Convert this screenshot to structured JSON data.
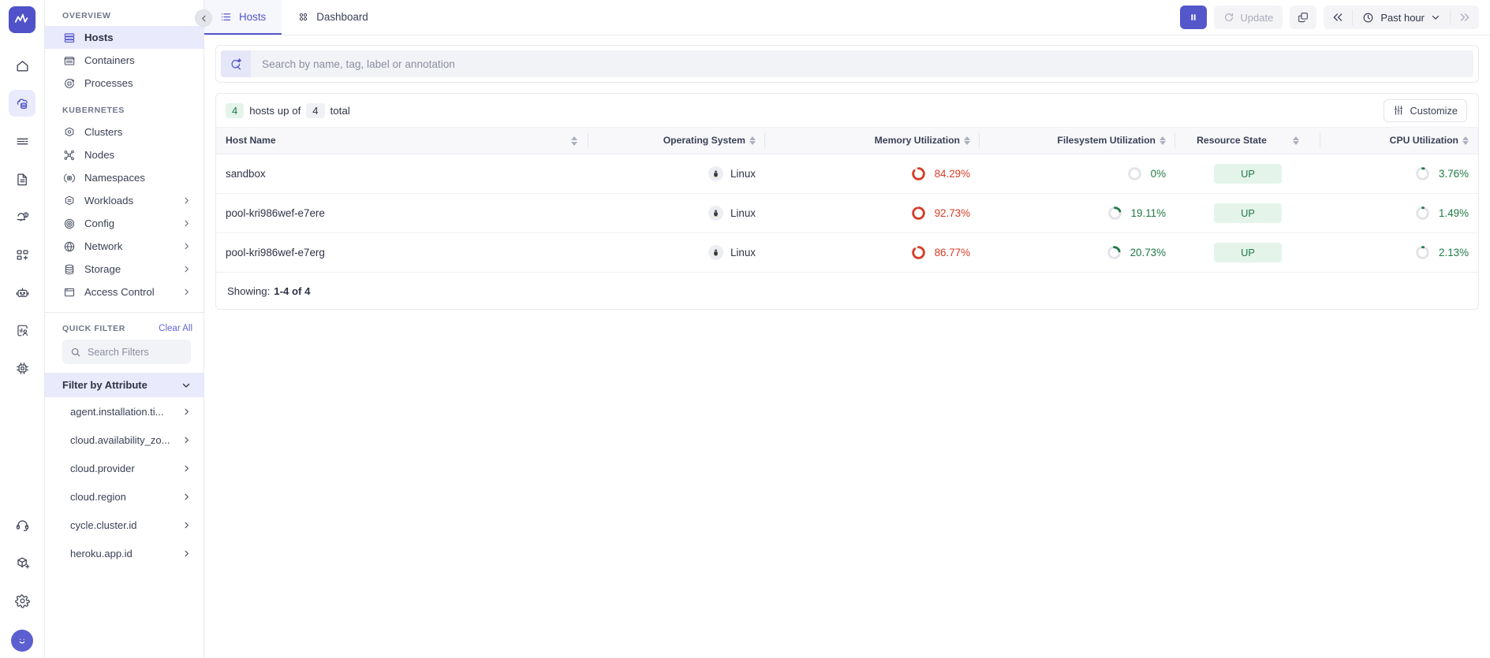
{
  "brand": {
    "logo_icon": "monitoring-wave-logo"
  },
  "rail": {
    "items": [
      {
        "name": "home",
        "icon": "home-icon",
        "active": false
      },
      {
        "name": "infrastructure",
        "icon": "cloud-stack-icon",
        "active": true
      },
      {
        "name": "logs",
        "icon": "logs-lines-icon",
        "active": false
      },
      {
        "name": "traces",
        "icon": "document-traces-icon",
        "active": false
      },
      {
        "name": "alerts",
        "icon": "alert-bell-icon",
        "active": false
      },
      {
        "name": "integrations",
        "icon": "add-node-icon",
        "active": false
      },
      {
        "name": "ai-assistant",
        "icon": "robot-icon",
        "active": false
      },
      {
        "name": "rum",
        "icon": "user-insights-icon",
        "active": false
      },
      {
        "name": "settings-chip",
        "icon": "cpu-chip-icon",
        "active": false
      }
    ],
    "bottom_items": [
      {
        "name": "support",
        "icon": "headset-icon"
      },
      {
        "name": "new-resource",
        "icon": "cube-plus-icon"
      },
      {
        "name": "settings",
        "icon": "gear-icon"
      }
    ],
    "avatar": "smiley-avatar"
  },
  "sidebar": {
    "collapse_icon": "chevron-left-icon",
    "sections": [
      {
        "label": "OVERVIEW",
        "items": [
          {
            "label": "Hosts",
            "icon": "hosts-stack-icon",
            "selected": true,
            "expandable": false
          },
          {
            "label": "Containers",
            "icon": "container-icon",
            "selected": false,
            "expandable": false
          },
          {
            "label": "Processes",
            "icon": "processes-icon",
            "selected": false,
            "expandable": false
          }
        ]
      },
      {
        "label": "KUBERNETES",
        "items": [
          {
            "label": "Clusters",
            "icon": "cluster-hex-icon",
            "selected": false,
            "expandable": false
          },
          {
            "label": "Nodes",
            "icon": "nodes-graph-icon",
            "selected": false,
            "expandable": false
          },
          {
            "label": "Namespaces",
            "icon": "namespace-icon",
            "selected": false,
            "expandable": false
          },
          {
            "label": "Workloads",
            "icon": "workloads-hex-icon",
            "selected": false,
            "expandable": true
          },
          {
            "label": "Config",
            "icon": "config-target-icon",
            "selected": false,
            "expandable": true
          },
          {
            "label": "Network",
            "icon": "globe-icon",
            "selected": false,
            "expandable": true
          },
          {
            "label": "Storage",
            "icon": "storage-db-icon",
            "selected": false,
            "expandable": true
          },
          {
            "label": "Access Control",
            "icon": "access-card-icon",
            "selected": false,
            "expandable": true
          }
        ]
      }
    ],
    "quick_filter": {
      "title": "QUICK FILTER",
      "clear_all": "Clear All",
      "search_placeholder": "Search Filters",
      "search_value": "",
      "search_icon": "search-icon",
      "attribute_header": "Filter by Attribute",
      "attribute_chevron": "chevron-down-icon",
      "attributes": [
        "agent.installation.ti...",
        "cloud.availability_zo...",
        "cloud.provider",
        "cloud.region",
        "cycle.cluster.id",
        "heroku.app.id"
      ]
    }
  },
  "topbar": {
    "tabs": [
      {
        "label": "Hosts",
        "icon": "list-icon",
        "active": true
      },
      {
        "label": "Dashboard",
        "icon": "grid-dots-icon",
        "active": false
      }
    ],
    "pause_button": {
      "name": "pause-button",
      "icon": "pause-icon"
    },
    "update_button": {
      "label": "Update",
      "icon": "refresh-icon",
      "disabled": true
    },
    "copy_button": {
      "name": "copy-button",
      "icon": "copy-icon"
    },
    "time_nav_prev": "double-chevron-left-icon",
    "time_nav_next": "double-chevron-right-icon",
    "time_range": {
      "label": "Past hour",
      "icon": "clock-icon",
      "chevron": "chevron-down-icon"
    }
  },
  "search": {
    "placeholder": "Search by name, tag, label or annotation",
    "value": "",
    "icon": "ai-search-icon"
  },
  "table": {
    "summary": {
      "up_count": "4",
      "mid_text": "hosts up of",
      "total_count": "4",
      "tail_text": "total"
    },
    "customize": {
      "label": "Customize",
      "icon": "sliders-icon"
    },
    "columns": [
      {
        "key": "host_name",
        "label": "Host Name",
        "align": "left",
        "sortable": true
      },
      {
        "key": "operating_system",
        "label": "Operating System",
        "align": "right",
        "sortable": true
      },
      {
        "key": "memory_utilization",
        "label": "Memory Utilization",
        "align": "right",
        "sortable": true
      },
      {
        "key": "filesystem_utilization",
        "label": "Filesystem Utilization",
        "align": "right",
        "sortable": true
      },
      {
        "key": "resource_state",
        "label": "Resource State",
        "align": "center",
        "sortable": true
      },
      {
        "key": "cpu_utilization",
        "label": "CPU Utilization",
        "align": "right",
        "sortable": true
      }
    ],
    "rows": [
      {
        "host_name": "sandbox",
        "operating_system": "Linux",
        "os_icon": "linux-penguin-icon",
        "memory_utilization": "84.29%",
        "memory_value": 84.29,
        "memory_color": "#d63c26",
        "filesystem_utilization": "0%",
        "filesystem_value": 0,
        "filesystem_color": "#1f7a45",
        "resource_state": "UP",
        "cpu_utilization": "3.76%",
        "cpu_value": 3.76,
        "cpu_color": "#1f7a45"
      },
      {
        "host_name": "pool-kri986wef-e7ere",
        "operating_system": "Linux",
        "os_icon": "linux-penguin-icon",
        "memory_utilization": "92.73%",
        "memory_value": 92.73,
        "memory_color": "#d63c26",
        "filesystem_utilization": "19.11%",
        "filesystem_value": 19.11,
        "filesystem_color": "#1f7a45",
        "resource_state": "UP",
        "cpu_utilization": "1.49%",
        "cpu_value": 1.49,
        "cpu_color": "#1f7a45"
      },
      {
        "host_name": "pool-kri986wef-e7erg",
        "operating_system": "Linux",
        "os_icon": "linux-penguin-icon",
        "memory_utilization": "86.77%",
        "memory_value": 86.77,
        "memory_color": "#d63c26",
        "filesystem_utilization": "20.73%",
        "filesystem_value": 20.73,
        "filesystem_color": "#1f7a45",
        "resource_state": "UP",
        "cpu_utilization": "2.13%",
        "cpu_value": 2.13,
        "cpu_color": "#1f7a45"
      }
    ],
    "footer": {
      "prefix": "Showing:",
      "range": "1-4 of 4"
    }
  },
  "colors": {
    "accent": "#5457c9",
    "accent_soft": "#e9eafb",
    "green": "#1f7a45",
    "red": "#d63c26",
    "border": "#e8e9ef"
  }
}
